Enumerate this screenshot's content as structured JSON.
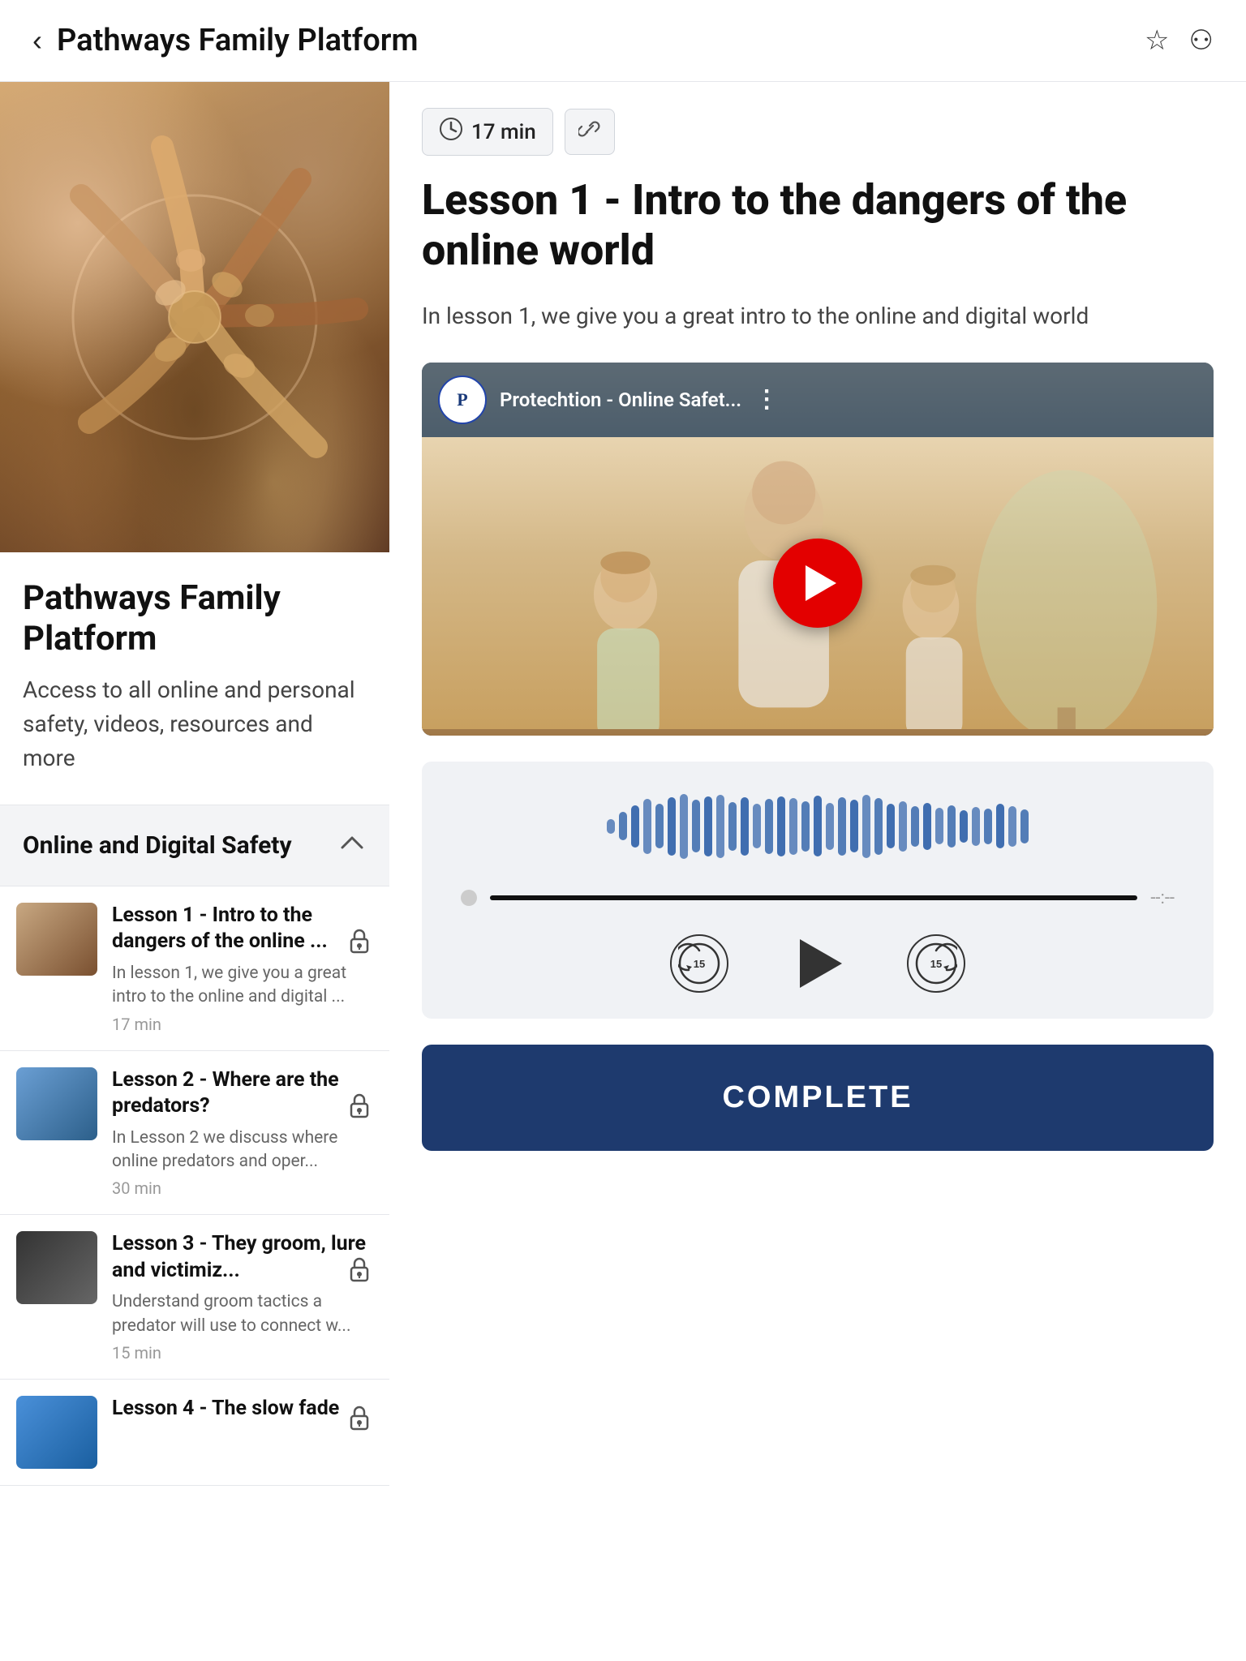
{
  "header": {
    "title": "Pathways Family Platform",
    "back_label": "‹",
    "bookmark_icon": "☆",
    "link_icon": "⚇"
  },
  "left_panel": {
    "platform_title": "Pathways Family Platform",
    "platform_desc": "Access to all online and personal safety, videos, resources and more",
    "section_title": "Online and Digital Safety",
    "lessons": [
      {
        "title": "Lesson 1 - Intro to the dangers of the online ...",
        "desc": "In lesson 1, we give you a great intro to the online and digital ...",
        "duration": "17 min",
        "locked": true,
        "thumb_class": "lesson-thumb-1"
      },
      {
        "title": "Lesson 2 - Where are the predators?",
        "desc": "In Lesson 2 we discuss where online predators and oper...",
        "duration": "30 min",
        "locked": true,
        "thumb_class": "lesson-thumb-2"
      },
      {
        "title": "Lesson 3 - They groom, lure and victimiz...",
        "desc": "Understand groom tactics a predator will use to connect w...",
        "duration": "15 min",
        "locked": true,
        "thumb_class": "lesson-thumb-3"
      },
      {
        "title": "Lesson 4 - The slow fade",
        "desc": "",
        "duration": "",
        "locked": true,
        "thumb_class": "lesson-thumb-4"
      }
    ]
  },
  "right_panel": {
    "duration_label": "17 min",
    "lesson_title": "Lesson 1 - Intro to the dangers of the online world",
    "lesson_desc": "In lesson 1, we give you a great intro to the online and digital world",
    "video": {
      "channel_initial": "P",
      "channel_name": "Protechtion - Online Safet..."
    },
    "audio": {
      "progress_time": "--:--"
    },
    "complete_label": "COMPLETE"
  },
  "icons": {
    "clock": "🕐",
    "link": "⚇",
    "lock": "🔒",
    "chevron_up": "^",
    "rewind_15": "15",
    "forward_15": "15"
  },
  "waveform_bars": [
    18,
    35,
    52,
    68,
    55,
    72,
    80,
    65,
    74,
    78,
    60,
    72,
    55,
    68,
    74,
    70,
    62,
    75,
    58,
    72,
    65,
    78,
    70,
    55,
    62,
    50,
    58,
    45,
    52,
    40,
    48,
    44,
    55,
    50,
    42
  ]
}
